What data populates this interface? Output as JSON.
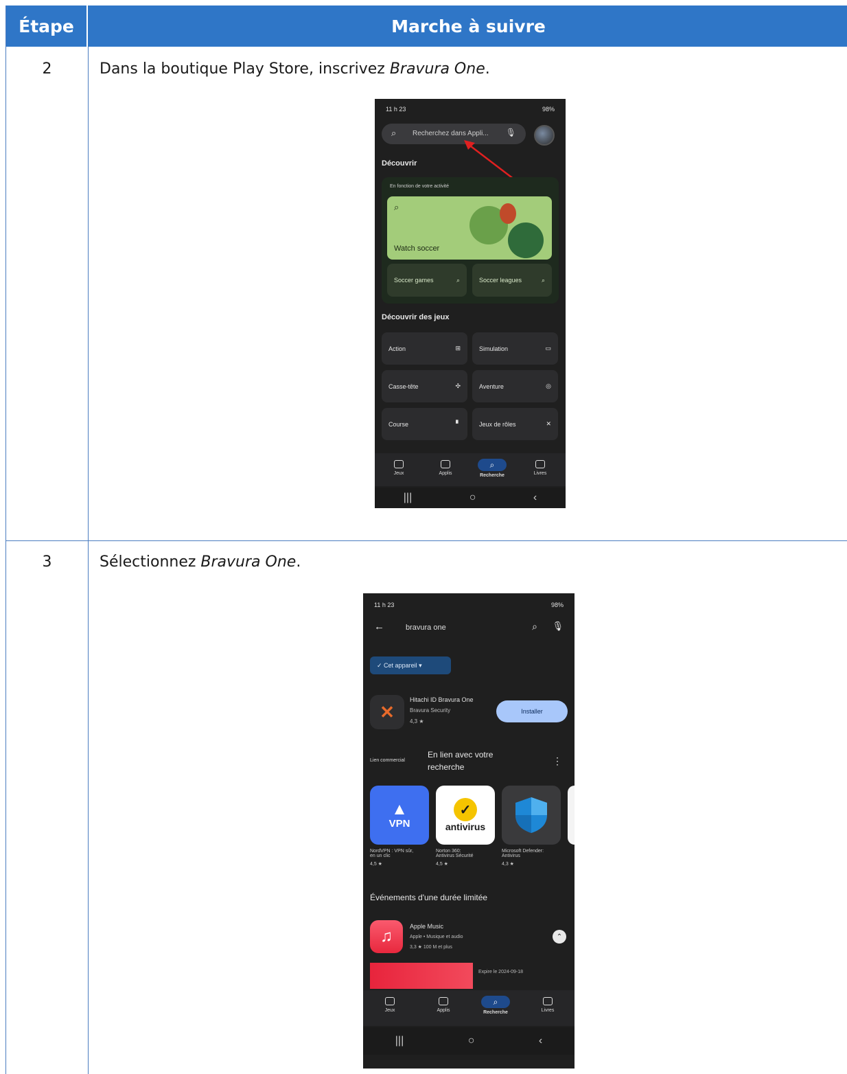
{
  "table": {
    "col_step": "Étape",
    "col_instructions": "Marche à suivre"
  },
  "rows": [
    {
      "num": "2",
      "text_before": "Dans la boutique Play Store, inscrivez ",
      "text_italic": "Bravura One",
      "text_after": "."
    },
    {
      "num": "3",
      "text_before": "Sélectionnez ",
      "text_italic": "Bravura One",
      "text_after": "."
    }
  ],
  "phone1": {
    "time": "11 h 23",
    "battery": "98%",
    "search_placeholder": "Recherchez dans Appli...",
    "section_discover": "Découvrir",
    "card_caption": "En fonction de votre activité",
    "card_title": "Watch soccer",
    "chip1": "Soccer games",
    "chip2": "Soccer leagues",
    "section_games": "Découvrir des jeux",
    "categories": [
      "Action",
      "Simulation",
      "Casse-tête",
      "Aventure",
      "Course",
      "Jeux de rôles"
    ],
    "nav": [
      "Jeux",
      "Applis",
      "Recherche",
      "Livres"
    ]
  },
  "phone2": {
    "time": "11 h 23",
    "battery": "98%",
    "query": "bravura one",
    "filter_chip": "Cet appareil",
    "app_name": "Hitachi ID Bravura One",
    "app_dev": "Bravura Security",
    "app_rating": "4,3 ★",
    "install_label": "Installer",
    "sponsored": "Lien commercial",
    "related_title_1": "En lien avec votre",
    "related_title_2": "recherche",
    "related": [
      {
        "icon_text": "VPN",
        "name1": "NordVPN : VPN sûr,",
        "name2": "en un clic",
        "rating": "4,5 ★"
      },
      {
        "icon_text": "antivirus",
        "name1": "Norton 360:",
        "name2": "Antivirus Sécurité",
        "rating": "4,5 ★"
      },
      {
        "icon_text": "",
        "name1": "Microsoft Defender:",
        "name2": "Antivirus",
        "rating": "4,3 ★"
      }
    ],
    "events_title": "Événements d'une durée limitée",
    "event_app": "Apple Music",
    "event_dev": "Apple • Musique et audio",
    "event_meta": "3,3 ★   100 M et plus",
    "event_expire": "Expire le 2024-09-18",
    "nav": [
      "Jeux",
      "Applis",
      "Recherche",
      "Livres"
    ]
  },
  "colors": {
    "header_blue": "#2f76c7",
    "border_blue": "#4a7cc0",
    "phone_bg": "#1f1f1f"
  }
}
